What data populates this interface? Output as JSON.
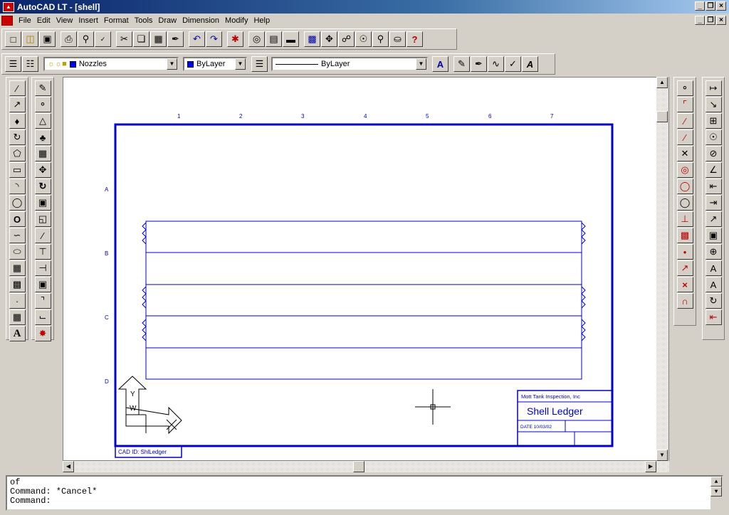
{
  "window": {
    "title": "AutoCAD LT - [shell]",
    "app_icon": "autocad-icon",
    "controls": [
      "_",
      "̸",
      "x"
    ]
  },
  "menu": {
    "items": [
      "File",
      "Edit",
      "View",
      "Insert",
      "Format",
      "Tools",
      "Draw",
      "Dimension",
      "Modify",
      "Help"
    ]
  },
  "standard_toolbar": {
    "icons": [
      "new-icon",
      "open-icon",
      "save-icon",
      "print-icon",
      "preview-icon",
      "spell-icon",
      "cut-icon",
      "copy-icon",
      "paste-icon",
      "match-props-icon",
      "undo-icon",
      "redo-icon",
      "snap-icon",
      "osnap-icon",
      "tracking-icon",
      "pan-icon",
      "zoom-realtime-icon",
      "zoom-icon",
      "zoom-window-icon",
      "zoom-previous-icon",
      "aerial-view-icon",
      "help-icon"
    ],
    "help_label": "?"
  },
  "object_toolbar": {
    "layer_value": "Nozzles",
    "color_value": "ByLayer",
    "linetype_value": "ByLayer",
    "accent_color": "#0000ff"
  },
  "drawing": {
    "column_labels": [
      "1",
      "2",
      "3",
      "4",
      "5",
      "6",
      "7"
    ],
    "row_labels": [
      "A",
      "B",
      "C",
      "D"
    ],
    "title_block": {
      "company": "Mott Tank Inspection, Inc",
      "title": "Shell Ledger",
      "date": "DATE 10/03/02"
    },
    "cad_id": "CAD ID: ShlLedger",
    "ucs_labels": {
      "y": "Y",
      "w": "W"
    },
    "line_color": "#0000cc"
  },
  "command_line": {
    "lines": [
      "of",
      "Command: *Cancel*",
      "Command:"
    ]
  }
}
